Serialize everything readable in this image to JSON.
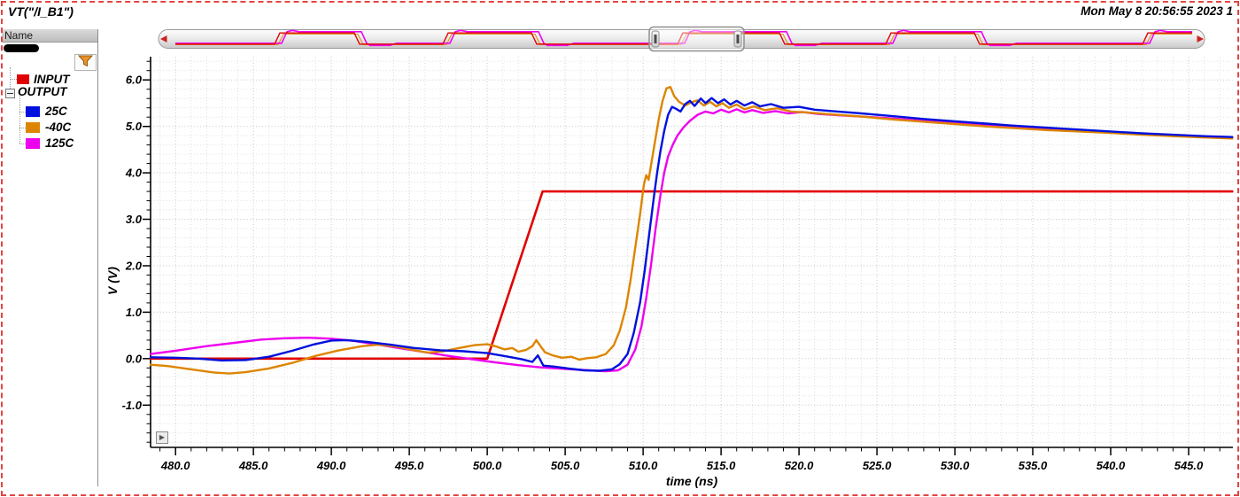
{
  "window": {
    "title": "VT(\"/I_B1\")",
    "timestamp": "Mon May 8 20:56:55 2023  1"
  },
  "sidebar": {
    "name_header": "Name",
    "tree": {
      "input": {
        "label": "INPUT",
        "color": "#e10000"
      },
      "output": {
        "label": "OUTPUT",
        "children": [
          {
            "label": "25C",
            "color": "#0011dd"
          },
          {
            "label": "-40C",
            "color": "#dd8500"
          },
          {
            "label": "125C",
            "color": "#ee00ee"
          }
        ]
      }
    }
  },
  "minimap": {
    "pulses": [
      [
        132,
        222
      ],
      [
        322,
        422
      ],
      [
        587,
        702
      ],
      [
        822,
        922
      ],
      [
        1112,
        1182
      ]
    ],
    "window": {
      "x": 555,
      "width": 107
    },
    "arrow_color": "#cc2020"
  },
  "chart_data": {
    "type": "line",
    "title": "VT(\"/I_B1\")",
    "xlabel": "time (ns)",
    "ylabel": "V (V)",
    "xlim": [
      478.4,
      547.84
    ],
    "ylim": [
      -1.91,
      6.5
    ],
    "x_major_step": 5,
    "x_minor_step": 1,
    "y_major_step": 1,
    "y_minor_step": 0.2,
    "grid": "dotted",
    "legend_position": "left-panel",
    "x_tick_values": [
      480,
      485,
      490,
      495,
      500,
      505,
      510,
      515,
      520,
      525,
      530,
      535,
      540,
      545
    ],
    "x_tick_labels": [
      "480.0",
      "485.0",
      "490.0",
      "495.0",
      "500.0",
      "505.0",
      "510.0",
      "515.0",
      "520.0",
      "525.0",
      "530.0",
      "535.0",
      "540.0",
      "545.0"
    ],
    "y_tick_values": [
      -1,
      0,
      1,
      2,
      3,
      4,
      5,
      6
    ],
    "y_tick_labels": [
      "-1.0",
      "0.0",
      "1.0",
      "2.0",
      "3.0",
      "4.0",
      "5.0",
      "6.0"
    ],
    "series": [
      {
        "name": "INPUT",
        "color": "#e10000",
        "width": 2.6,
        "points": [
          [
            478.4,
            0
          ],
          [
            500.0,
            0
          ],
          [
            503.55,
            3.6
          ],
          [
            547.8,
            3.6
          ]
        ]
      },
      {
        "name": "125C",
        "color": "#ee00ee",
        "width": 2.4,
        "points": [
          [
            478.4,
            0.1
          ],
          [
            480,
            0.17
          ],
          [
            482,
            0.27
          ],
          [
            484,
            0.35
          ],
          [
            485.5,
            0.41
          ],
          [
            487,
            0.44
          ],
          [
            488.5,
            0.45
          ],
          [
            490,
            0.43
          ],
          [
            491.5,
            0.38
          ],
          [
            493,
            0.3
          ],
          [
            494.5,
            0.22
          ],
          [
            496,
            0.14
          ],
          [
            497.5,
            0.06
          ],
          [
            499,
            -0.01
          ],
          [
            500.5,
            -0.08
          ],
          [
            502,
            -0.14
          ],
          [
            503.5,
            -0.19
          ],
          [
            505,
            -0.22
          ],
          [
            506.5,
            -0.25
          ],
          [
            507.6,
            -0.27
          ],
          [
            508.4,
            -0.25
          ],
          [
            509,
            -0.13
          ],
          [
            509.5,
            0.2
          ],
          [
            509.9,
            0.7
          ],
          [
            510.2,
            1.3
          ],
          [
            510.5,
            2.0
          ],
          [
            510.8,
            2.8
          ],
          [
            511.1,
            3.5
          ],
          [
            511.35,
            4.0
          ],
          [
            511.6,
            4.35
          ],
          [
            511.9,
            4.6
          ],
          [
            512.2,
            4.8
          ],
          [
            512.6,
            4.98
          ],
          [
            513,
            5.12
          ],
          [
            513.5,
            5.25
          ],
          [
            514,
            5.32
          ],
          [
            514.5,
            5.28
          ],
          [
            515,
            5.36
          ],
          [
            515.5,
            5.3
          ],
          [
            516,
            5.37
          ],
          [
            516.5,
            5.3
          ],
          [
            517,
            5.35
          ],
          [
            517.7,
            5.29
          ],
          [
            518.5,
            5.33
          ],
          [
            519.3,
            5.28
          ],
          [
            520.2,
            5.31
          ],
          [
            521.2,
            5.27
          ],
          [
            522.5,
            5.24
          ],
          [
            524,
            5.21
          ],
          [
            526,
            5.17
          ],
          [
            528,
            5.12
          ],
          [
            530,
            5.08
          ],
          [
            532,
            5.04
          ],
          [
            534,
            5.0
          ],
          [
            536,
            4.96
          ],
          [
            538,
            4.92
          ],
          [
            540,
            4.88
          ],
          [
            542,
            4.84
          ],
          [
            544,
            4.8
          ],
          [
            546,
            4.77
          ],
          [
            547.8,
            4.75
          ]
        ]
      },
      {
        "name": "-40C",
        "color": "#dd8500",
        "width": 2.4,
        "points": [
          [
            478.4,
            -0.13
          ],
          [
            479.5,
            -0.16
          ],
          [
            481,
            -0.23
          ],
          [
            482.5,
            -0.3
          ],
          [
            483.5,
            -0.32
          ],
          [
            484.5,
            -0.29
          ],
          [
            486,
            -0.21
          ],
          [
            487.5,
            -0.09
          ],
          [
            489,
            0.06
          ],
          [
            490.5,
            0.18
          ],
          [
            492,
            0.27
          ],
          [
            493,
            0.3
          ],
          [
            494.2,
            0.26
          ],
          [
            495.2,
            0.19
          ],
          [
            496.2,
            0.13
          ],
          [
            497.2,
            0.16
          ],
          [
            498.2,
            0.23
          ],
          [
            499.2,
            0.29
          ],
          [
            500,
            0.31
          ],
          [
            500.6,
            0.26
          ],
          [
            501.1,
            0.2
          ],
          [
            501.6,
            0.23
          ],
          [
            502,
            0.15
          ],
          [
            502.5,
            0.19
          ],
          [
            502.9,
            0.27
          ],
          [
            503.15,
            0.4
          ],
          [
            503.4,
            0.28
          ],
          [
            503.7,
            0.14
          ],
          [
            504.2,
            0.07
          ],
          [
            504.8,
            0.02
          ],
          [
            505.4,
            0.04
          ],
          [
            505.9,
            -0.02
          ],
          [
            506.4,
            0.01
          ],
          [
            507,
            0.03
          ],
          [
            507.6,
            0.1
          ],
          [
            508.1,
            0.28
          ],
          [
            508.5,
            0.6
          ],
          [
            508.9,
            1.1
          ],
          [
            509.2,
            1.7
          ],
          [
            509.5,
            2.4
          ],
          [
            509.8,
            3.1
          ],
          [
            510.05,
            3.75
          ],
          [
            510.2,
            3.95
          ],
          [
            510.35,
            3.85
          ],
          [
            510.5,
            4.15
          ],
          [
            510.75,
            4.65
          ],
          [
            511,
            5.15
          ],
          [
            511.25,
            5.55
          ],
          [
            511.5,
            5.82
          ],
          [
            511.75,
            5.85
          ],
          [
            512,
            5.65
          ],
          [
            512.3,
            5.53
          ],
          [
            512.7,
            5.45
          ],
          [
            513.1,
            5.52
          ],
          [
            513.5,
            5.56
          ],
          [
            513.9,
            5.45
          ],
          [
            514.3,
            5.53
          ],
          [
            514.7,
            5.43
          ],
          [
            515.1,
            5.5
          ],
          [
            515.5,
            5.4
          ],
          [
            516,
            5.47
          ],
          [
            516.5,
            5.37
          ],
          [
            517.1,
            5.43
          ],
          [
            517.8,
            5.35
          ],
          [
            518.6,
            5.39
          ],
          [
            519.5,
            5.32
          ],
          [
            520.5,
            5.3
          ],
          [
            522,
            5.26
          ],
          [
            524,
            5.21
          ],
          [
            526,
            5.15
          ],
          [
            528,
            5.1
          ],
          [
            530,
            5.05
          ],
          [
            532,
            5.0
          ],
          [
            534,
            4.96
          ],
          [
            536,
            4.92
          ],
          [
            538,
            4.89
          ],
          [
            540,
            4.86
          ],
          [
            542,
            4.82
          ],
          [
            544,
            4.79
          ],
          [
            546,
            4.76
          ],
          [
            547.8,
            4.74
          ]
        ]
      },
      {
        "name": "25C",
        "color": "#0011dd",
        "width": 2.4,
        "points": [
          [
            478.4,
            0.03
          ],
          [
            480,
            0.02
          ],
          [
            481.5,
            0.0
          ],
          [
            483,
            -0.04
          ],
          [
            484.5,
            -0.03
          ],
          [
            486,
            0.04
          ],
          [
            487.5,
            0.17
          ],
          [
            488.8,
            0.3
          ],
          [
            490,
            0.39
          ],
          [
            491,
            0.4
          ],
          [
            492.3,
            0.36
          ],
          [
            493.8,
            0.3
          ],
          [
            495.3,
            0.23
          ],
          [
            497,
            0.18
          ],
          [
            498.5,
            0.16
          ],
          [
            500,
            0.12
          ],
          [
            501.2,
            0.05
          ],
          [
            502.2,
            -0.01
          ],
          [
            502.9,
            -0.07
          ],
          [
            503.25,
            0.07
          ],
          [
            503.6,
            -0.15
          ],
          [
            504.3,
            -0.17
          ],
          [
            505.2,
            -0.21
          ],
          [
            506.2,
            -0.25
          ],
          [
            507.2,
            -0.26
          ],
          [
            508,
            -0.23
          ],
          [
            508.5,
            -0.12
          ],
          [
            509,
            0.1
          ],
          [
            509.4,
            0.55
          ],
          [
            509.8,
            1.2
          ],
          [
            510.1,
            1.9
          ],
          [
            510.4,
            2.7
          ],
          [
            510.7,
            3.5
          ],
          [
            510.9,
            4.0
          ],
          [
            511.1,
            4.45
          ],
          [
            511.35,
            4.9
          ],
          [
            511.6,
            5.25
          ],
          [
            511.85,
            5.42
          ],
          [
            512.1,
            5.38
          ],
          [
            512.4,
            5.32
          ],
          [
            512.7,
            5.48
          ],
          [
            513,
            5.55
          ],
          [
            513.3,
            5.44
          ],
          [
            513.7,
            5.6
          ],
          [
            514,
            5.5
          ],
          [
            514.4,
            5.61
          ],
          [
            514.8,
            5.5
          ],
          [
            515.2,
            5.58
          ],
          [
            515.6,
            5.47
          ],
          [
            516,
            5.55
          ],
          [
            516.5,
            5.45
          ],
          [
            517,
            5.52
          ],
          [
            517.5,
            5.43
          ],
          [
            518.2,
            5.48
          ],
          [
            519,
            5.4
          ],
          [
            520,
            5.42
          ],
          [
            521,
            5.36
          ],
          [
            522.5,
            5.32
          ],
          [
            524,
            5.28
          ],
          [
            526,
            5.22
          ],
          [
            528,
            5.16
          ],
          [
            530,
            5.11
          ],
          [
            532,
            5.06
          ],
          [
            534,
            5.01
          ],
          [
            536,
            4.97
          ],
          [
            538,
            4.93
          ],
          [
            540,
            4.89
          ],
          [
            542,
            4.85
          ],
          [
            544,
            4.82
          ],
          [
            546,
            4.79
          ],
          [
            547.8,
            4.77
          ]
        ]
      }
    ]
  }
}
